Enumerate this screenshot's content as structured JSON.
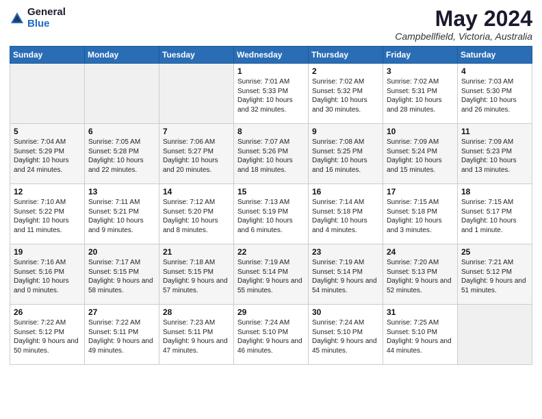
{
  "header": {
    "logo_line1": "General",
    "logo_line2": "Blue",
    "month": "May 2024",
    "location": "Campbellfield, Victoria, Australia"
  },
  "weekdays": [
    "Sunday",
    "Monday",
    "Tuesday",
    "Wednesday",
    "Thursday",
    "Friday",
    "Saturday"
  ],
  "weeks": [
    [
      {
        "day": "",
        "sunrise": "",
        "sunset": "",
        "daylight": "",
        "empty": true
      },
      {
        "day": "",
        "sunrise": "",
        "sunset": "",
        "daylight": "",
        "empty": true
      },
      {
        "day": "",
        "sunrise": "",
        "sunset": "",
        "daylight": "",
        "empty": true
      },
      {
        "day": "1",
        "sunrise": "Sunrise: 7:01 AM",
        "sunset": "Sunset: 5:33 PM",
        "daylight": "Daylight: 10 hours and 32 minutes."
      },
      {
        "day": "2",
        "sunrise": "Sunrise: 7:02 AM",
        "sunset": "Sunset: 5:32 PM",
        "daylight": "Daylight: 10 hours and 30 minutes."
      },
      {
        "day": "3",
        "sunrise": "Sunrise: 7:02 AM",
        "sunset": "Sunset: 5:31 PM",
        "daylight": "Daylight: 10 hours and 28 minutes."
      },
      {
        "day": "4",
        "sunrise": "Sunrise: 7:03 AM",
        "sunset": "Sunset: 5:30 PM",
        "daylight": "Daylight: 10 hours and 26 minutes."
      }
    ],
    [
      {
        "day": "5",
        "sunrise": "Sunrise: 7:04 AM",
        "sunset": "Sunset: 5:29 PM",
        "daylight": "Daylight: 10 hours and 24 minutes."
      },
      {
        "day": "6",
        "sunrise": "Sunrise: 7:05 AM",
        "sunset": "Sunset: 5:28 PM",
        "daylight": "Daylight: 10 hours and 22 minutes."
      },
      {
        "day": "7",
        "sunrise": "Sunrise: 7:06 AM",
        "sunset": "Sunset: 5:27 PM",
        "daylight": "Daylight: 10 hours and 20 minutes."
      },
      {
        "day": "8",
        "sunrise": "Sunrise: 7:07 AM",
        "sunset": "Sunset: 5:26 PM",
        "daylight": "Daylight: 10 hours and 18 minutes."
      },
      {
        "day": "9",
        "sunrise": "Sunrise: 7:08 AM",
        "sunset": "Sunset: 5:25 PM",
        "daylight": "Daylight: 10 hours and 16 minutes."
      },
      {
        "day": "10",
        "sunrise": "Sunrise: 7:09 AM",
        "sunset": "Sunset: 5:24 PM",
        "daylight": "Daylight: 10 hours and 15 minutes."
      },
      {
        "day": "11",
        "sunrise": "Sunrise: 7:09 AM",
        "sunset": "Sunset: 5:23 PM",
        "daylight": "Daylight: 10 hours and 13 minutes."
      }
    ],
    [
      {
        "day": "12",
        "sunrise": "Sunrise: 7:10 AM",
        "sunset": "Sunset: 5:22 PM",
        "daylight": "Daylight: 10 hours and 11 minutes."
      },
      {
        "day": "13",
        "sunrise": "Sunrise: 7:11 AM",
        "sunset": "Sunset: 5:21 PM",
        "daylight": "Daylight: 10 hours and 9 minutes."
      },
      {
        "day": "14",
        "sunrise": "Sunrise: 7:12 AM",
        "sunset": "Sunset: 5:20 PM",
        "daylight": "Daylight: 10 hours and 8 minutes."
      },
      {
        "day": "15",
        "sunrise": "Sunrise: 7:13 AM",
        "sunset": "Sunset: 5:19 PM",
        "daylight": "Daylight: 10 hours and 6 minutes."
      },
      {
        "day": "16",
        "sunrise": "Sunrise: 7:14 AM",
        "sunset": "Sunset: 5:18 PM",
        "daylight": "Daylight: 10 hours and 4 minutes."
      },
      {
        "day": "17",
        "sunrise": "Sunrise: 7:15 AM",
        "sunset": "Sunset: 5:18 PM",
        "daylight": "Daylight: 10 hours and 3 minutes."
      },
      {
        "day": "18",
        "sunrise": "Sunrise: 7:15 AM",
        "sunset": "Sunset: 5:17 PM",
        "daylight": "Daylight: 10 hours and 1 minute."
      }
    ],
    [
      {
        "day": "19",
        "sunrise": "Sunrise: 7:16 AM",
        "sunset": "Sunset: 5:16 PM",
        "daylight": "Daylight: 10 hours and 0 minutes."
      },
      {
        "day": "20",
        "sunrise": "Sunrise: 7:17 AM",
        "sunset": "Sunset: 5:15 PM",
        "daylight": "Daylight: 9 hours and 58 minutes."
      },
      {
        "day": "21",
        "sunrise": "Sunrise: 7:18 AM",
        "sunset": "Sunset: 5:15 PM",
        "daylight": "Daylight: 9 hours and 57 minutes."
      },
      {
        "day": "22",
        "sunrise": "Sunrise: 7:19 AM",
        "sunset": "Sunset: 5:14 PM",
        "daylight": "Daylight: 9 hours and 55 minutes."
      },
      {
        "day": "23",
        "sunrise": "Sunrise: 7:19 AM",
        "sunset": "Sunset: 5:14 PM",
        "daylight": "Daylight: 9 hours and 54 minutes."
      },
      {
        "day": "24",
        "sunrise": "Sunrise: 7:20 AM",
        "sunset": "Sunset: 5:13 PM",
        "daylight": "Daylight: 9 hours and 52 minutes."
      },
      {
        "day": "25",
        "sunrise": "Sunrise: 7:21 AM",
        "sunset": "Sunset: 5:12 PM",
        "daylight": "Daylight: 9 hours and 51 minutes."
      }
    ],
    [
      {
        "day": "26",
        "sunrise": "Sunrise: 7:22 AM",
        "sunset": "Sunset: 5:12 PM",
        "daylight": "Daylight: 9 hours and 50 minutes."
      },
      {
        "day": "27",
        "sunrise": "Sunrise: 7:22 AM",
        "sunset": "Sunset: 5:11 PM",
        "daylight": "Daylight: 9 hours and 49 minutes."
      },
      {
        "day": "28",
        "sunrise": "Sunrise: 7:23 AM",
        "sunset": "Sunset: 5:11 PM",
        "daylight": "Daylight: 9 hours and 47 minutes."
      },
      {
        "day": "29",
        "sunrise": "Sunrise: 7:24 AM",
        "sunset": "Sunset: 5:10 PM",
        "daylight": "Daylight: 9 hours and 46 minutes."
      },
      {
        "day": "30",
        "sunrise": "Sunrise: 7:24 AM",
        "sunset": "Sunset: 5:10 PM",
        "daylight": "Daylight: 9 hours and 45 minutes."
      },
      {
        "day": "31",
        "sunrise": "Sunrise: 7:25 AM",
        "sunset": "Sunset: 5:10 PM",
        "daylight": "Daylight: 9 hours and 44 minutes."
      },
      {
        "day": "",
        "sunrise": "",
        "sunset": "",
        "daylight": "",
        "empty": true
      }
    ]
  ]
}
